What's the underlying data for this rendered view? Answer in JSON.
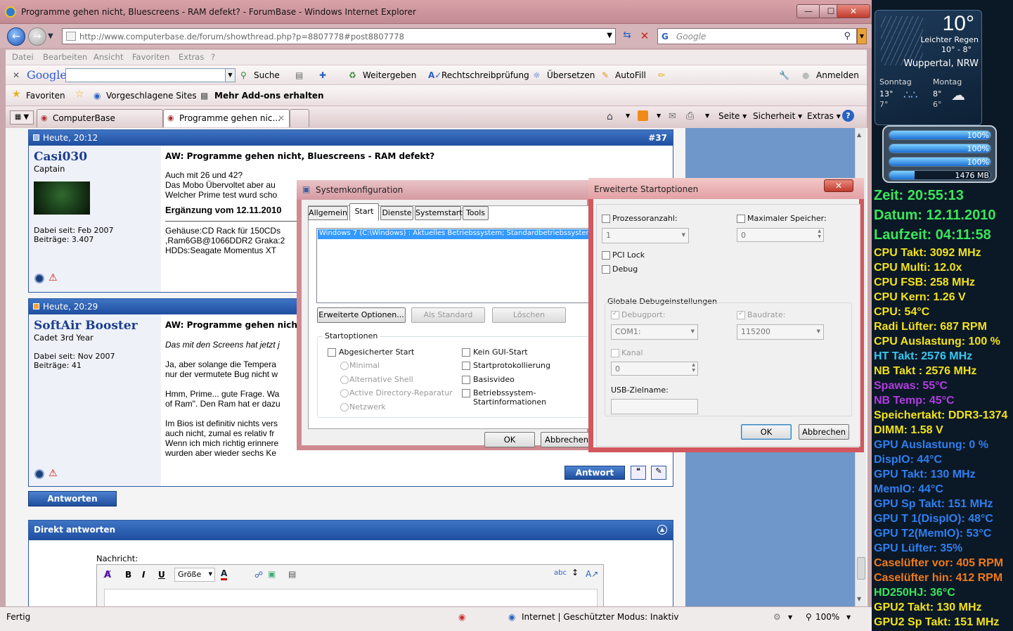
{
  "window": {
    "title": "Programme gehen nicht, Bluescreens - RAM defekt? - ForumBase - Windows Internet Explorer"
  },
  "nav": {
    "url": "http://www.computerbase.de/forum/showthread.php?p=8807778#post8807778",
    "search_placeholder": "Google"
  },
  "menubar": [
    "Datei",
    "Bearbeiten",
    "Ansicht",
    "Favoriten",
    "Extras",
    "?"
  ],
  "google_toolbar": {
    "logo": "Google",
    "search": "Suche",
    "share": "Weitergeben",
    "spell": "Rechtschreibprüfung",
    "translate": "Übersetzen",
    "autofill": "AutoFill",
    "signin": "Anmelden"
  },
  "favbar": {
    "favorites": "Favoriten",
    "suggested": "Vorgeschlagene Sites",
    "addons": "Mehr Add-ons erhalten"
  },
  "tabs": [
    {
      "label": "ComputerBase"
    },
    {
      "label": "Programme gehen nic..."
    }
  ],
  "cmdbar": {
    "page": "Seite",
    "security": "Sicherheit",
    "tools": "Extras"
  },
  "posts": [
    {
      "time": "Heute, 20:12",
      "num": "#37",
      "user": "Casi030",
      "rank": "Captain",
      "joined": "Dabei seit: Feb 2007",
      "posts": "Beiträge: 3.407",
      "title": "AW: Programme gehen nicht, Bluescreens - RAM defekt?",
      "lines": [
        "Auch mit 26 und 42?",
        "Das Mobo Übervoltet aber au",
        "Welcher Prime test wurd scho"
      ],
      "edit": "Ergänzung vom 12.11.2010",
      "sig": [
        "Gehäuse:CD Rack für 150CDs",
        ",Ram6GB@1066DDR2 Graka:2",
        "HDDs:Seagate Momentus XT"
      ]
    },
    {
      "time": "Heute, 20:29",
      "user": "SoftAir Booster",
      "rank": "Cadet 3rd Year",
      "joined": "Dabei seit: Nov 2007",
      "posts": "Beiträge: 41",
      "title": "AW: Programme gehen nicht",
      "quote": "Das mit den Screens hat jetzt j",
      "lines": [
        "Ja, aber solange die Tempera",
        "nur der vermutete Bug nicht w",
        "",
        "Hmm, Prime... gute Frage. Wa",
        "of Ram\". Den Ram hat er dazu",
        "",
        "Im Bios ist definitiv nichts vers",
        "auch nicht, zumal es relativ fr",
        "Wenn ich mich richtig erinnere",
        "wurden aber wieder sechs Ke"
      ],
      "answer": "Antwort"
    }
  ],
  "reply_button": "Antworten",
  "quick_reply": {
    "title": "Direkt antworten",
    "message_label": "Nachricht:",
    "size": "Größe"
  },
  "status": {
    "left": "Fertig",
    "zone": "Internet | Geschützter Modus: Inaktiv",
    "zoom": "100%"
  },
  "sysconfig": {
    "title": "Systemkonfiguration",
    "tabs": [
      "Allgemein",
      "Start",
      "Dienste",
      "Systemstart",
      "Tools"
    ],
    "entry": "Windows 7 (C:\\Windows) : Aktuelles Betriebssystem; Standardbetriebssystem",
    "btn_adv": "Erweiterte Optionen...",
    "btn_default": "Als Standard",
    "btn_delete": "Löschen",
    "group": "Startoptionen",
    "safe": "Abgesicherter Start",
    "minimal": "Minimal",
    "altshell": "Alternative Shell",
    "adrepair": "Active Directory-Reparatur",
    "network": "Netzwerk",
    "nogui": "Kein GUI-Start",
    "bootlog": "Startprotokollierung",
    "basevideo": "Basisvideo",
    "osinfo1": "Betriebssystem-",
    "osinfo2": "Startinformationen",
    "ok": "OK",
    "cancel": "Abbrechen"
  },
  "advanced": {
    "title": "Erweiterte Startoptionen",
    "proc": "Prozessoranzahl:",
    "proc_val": "1",
    "maxmem": "Maximaler Speicher:",
    "maxmem_val": "0",
    "pcilock": "PCI Lock",
    "debug": "Debug",
    "group": "Globale Debugeinstellungen",
    "debugport": "Debugport:",
    "port_val": "COM1:",
    "baud": "Baudrate:",
    "baud_val": "115200",
    "channel": "Kanal",
    "channel_val": "0",
    "usb": "USB-Zielname:",
    "ok": "OK",
    "cancel": "Abbrechen"
  },
  "weather": {
    "temp": "10°",
    "desc": "Leichter Regen",
    "range": "10° - 8°",
    "city": "Wuppertal, NRW",
    "d1": "Sonntag",
    "d1_hi": "13°",
    "d1_lo": "7°",
    "d2": "Montag",
    "d2_hi": "8°",
    "d2_lo": "6°"
  },
  "meters": [
    {
      "label": "100%",
      "level": 1.0
    },
    {
      "label": "100%",
      "level": 1.0
    },
    {
      "label": "100%",
      "level": 1.0
    },
    {
      "label": "1476 MB",
      "level": 0.25
    }
  ],
  "sensors": [
    {
      "text": "Zeit: 20:55:13",
      "color": "#39e65a"
    },
    {
      "text": "Datum: 12.11.2010",
      "color": "#39e65a"
    },
    {
      "text": "Laufzeit: 04:11:58",
      "color": "#39e65a"
    },
    {
      "text": "CPU Takt: 3092 MHz",
      "color": "#f2e21a"
    },
    {
      "text": "CPU Multi: 12.0x",
      "color": "#f2e21a"
    },
    {
      "text": "CPU FSB: 258 MHz",
      "color": "#f2e21a"
    },
    {
      "text": "CPU Kern: 1.26 V",
      "color": "#f2e21a"
    },
    {
      "text": "CPU: 54°C",
      "color": "#f2e21a"
    },
    {
      "text": "Radi Lüfter: 687 RPM",
      "color": "#f2e21a"
    },
    {
      "text": "CPU Auslastung: 100 %",
      "color": "#f2e21a"
    },
    {
      "text": "HT Takt: 2576 MHz",
      "color": "#38c8f0"
    },
    {
      "text": "NB Takt : 2576 MHz",
      "color": "#f2e21a"
    },
    {
      "text": "Spawas: 55°C",
      "color": "#b23ce0"
    },
    {
      "text": "NB Temp: 45°C",
      "color": "#b23ce0"
    },
    {
      "text": "Speichertakt: DDR3-1374",
      "color": "#f2e21a"
    },
    {
      "text": "DIMM: 1.58 V",
      "color": "#f2e21a"
    },
    {
      "text": "GPU Auslastung: 0 %",
      "color": "#2f7ff0"
    },
    {
      "text": "DispIO: 44°C",
      "color": "#2f7ff0"
    },
    {
      "text": "GPU Takt: 130 MHz",
      "color": "#2f7ff0"
    },
    {
      "text": "MemIO: 44°C",
      "color": "#2f7ff0"
    },
    {
      "text": "GPU Sp Takt: 151 MHz",
      "color": "#2f7ff0"
    },
    {
      "text": "GPU T 1(DispIO): 48°C",
      "color": "#2f7ff0"
    },
    {
      "text": "GPU T2(MemIO): 53°C",
      "color": "#2f7ff0"
    },
    {
      "text": "GPU Lüfter: 35%",
      "color": "#2f7ff0"
    },
    {
      "text": "Caselüfter vor: 405 RPM",
      "color": "#f07a1a"
    },
    {
      "text": "Caselüfter hin: 412 RPM",
      "color": "#f07a1a"
    },
    {
      "text": "HD250HJ: 36°C",
      "color": "#39e65a"
    },
    {
      "text": "GPU2 Takt: 130 MHz",
      "color": "#f2e21a"
    },
    {
      "text": "GPU2 Sp Takt: 151 MHz",
      "color": "#f2e21a"
    }
  ]
}
